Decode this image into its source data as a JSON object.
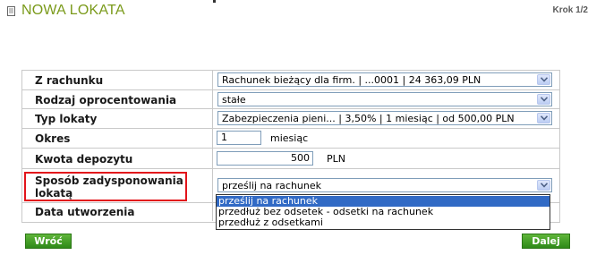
{
  "header": {
    "title": "NOWA LOKATA",
    "step": "Krok 1/2"
  },
  "form": {
    "rows": [
      {
        "label": "Z rachunku",
        "value": "Rachunek bieżący dla firm. | ...0001 | 24 363,09 PLN"
      },
      {
        "label": "Rodzaj oprocentowania",
        "value": "stałe"
      },
      {
        "label": "Typ lokaty",
        "value": "Zabezpieczenia pieni... | 3,50% | 1 miesiąc | od 500,00 PLN"
      },
      {
        "label": "Okres",
        "value": "1",
        "unit": "miesiąc"
      },
      {
        "label": "Kwota depozytu",
        "value": "500",
        "unit": "PLN"
      },
      {
        "label": "Sposób zadysponowania lokatą",
        "value": "prześlij na rachunek"
      },
      {
        "label": "Data utworzenia",
        "value": ""
      }
    ]
  },
  "dropdown": {
    "options": [
      "prześlij na rachunek",
      "przedłuż bez odsetek - odsetki na rachunek",
      "przedłuż z odsetkami"
    ],
    "selected_index": 0
  },
  "buttons": {
    "back": "Wróć",
    "next": "Dalej"
  },
  "colors": {
    "title": "#7a9a1a",
    "button": "#3c9a22",
    "highlight": "#e2141b",
    "selection": "#316ac5"
  }
}
